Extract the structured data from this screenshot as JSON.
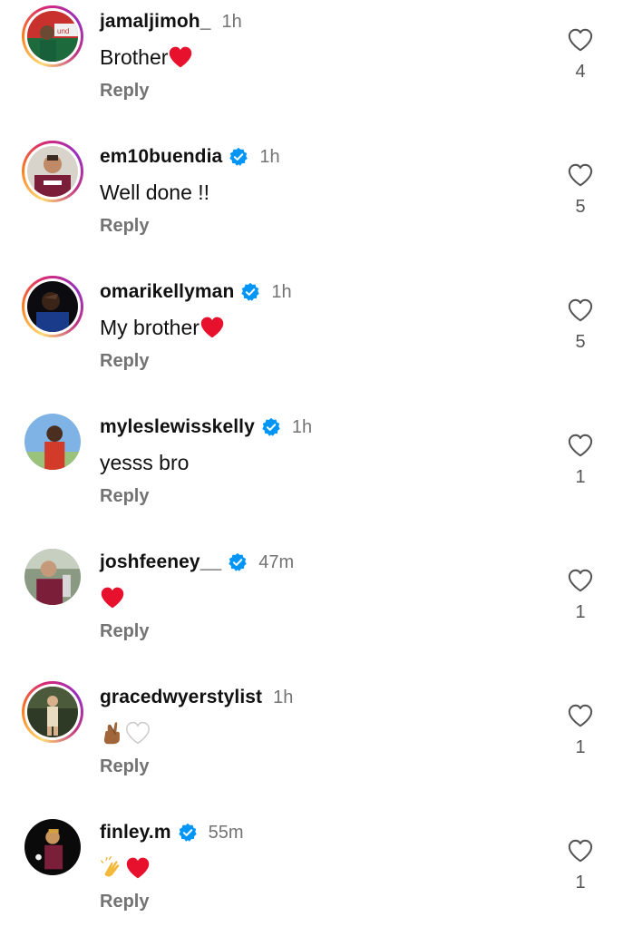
{
  "comments": [
    {
      "username": "jamaljimoh_",
      "verified": false,
      "time": "1h",
      "text": "Brother",
      "emojis": [
        "red-heart"
      ],
      "reply": "Reply",
      "likes": "4"
    },
    {
      "username": "em10buendia",
      "verified": true,
      "time": "1h",
      "text": "Well done !!",
      "emojis": [],
      "reply": "Reply",
      "likes": "5"
    },
    {
      "username": "omarikellyman",
      "verified": true,
      "time": "1h",
      "text": "My brother",
      "emojis": [
        "red-heart"
      ],
      "reply": "Reply",
      "likes": "5"
    },
    {
      "username": "myleslewisskelly",
      "verified": true,
      "time": "1h",
      "text": "yesss bro",
      "emojis": [],
      "reply": "Reply",
      "likes": "1"
    },
    {
      "username": "joshfeeney__",
      "verified": true,
      "time": "47m",
      "text": "",
      "emojis": [
        "red-heart"
      ],
      "reply": "Reply",
      "likes": "1"
    },
    {
      "username": "gracedwyerstylist",
      "verified": false,
      "time": "1h",
      "text": "",
      "emojis": [
        "crossed-fingers",
        "white-heart"
      ],
      "reply": "Reply",
      "likes": "1"
    },
    {
      "username": "finley.m",
      "verified": true,
      "time": "55m",
      "text": "",
      "emojis": [
        "clapping-hands",
        "red-heart"
      ],
      "reply": "Reply",
      "likes": "1"
    }
  ],
  "colors": {
    "verified_badge": "#0095f6",
    "muted_text": "#737373",
    "heart_red": "#e8112d"
  }
}
